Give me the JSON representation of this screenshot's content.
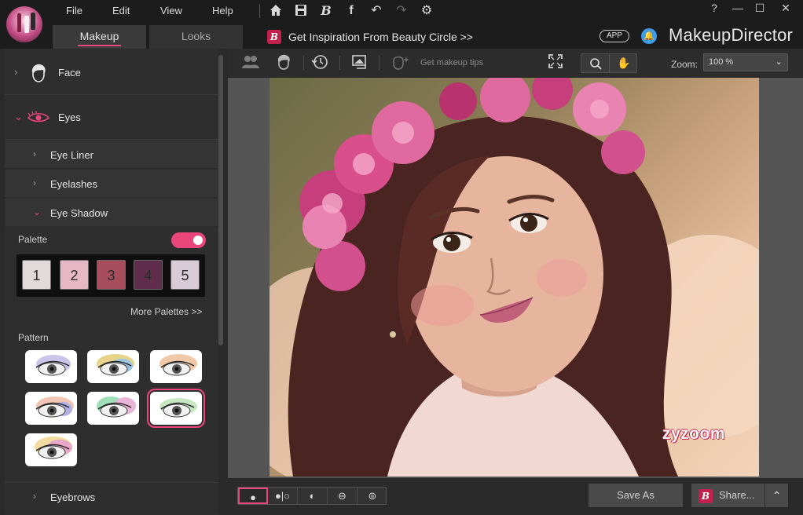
{
  "app": {
    "menu": [
      "File",
      "Edit",
      "View",
      "Help"
    ],
    "window_controls": [
      "?",
      "—",
      "☐",
      "✕"
    ],
    "tabs": [
      {
        "label": "Makeup",
        "active": true
      },
      {
        "label": "Looks",
        "active": false
      }
    ],
    "inspiration": "Get Inspiration From Beauty Circle >>",
    "badge_letter": "B",
    "app_button": "APP",
    "brand": "MakeupDirector",
    "toolbar_icons": [
      "home-icon",
      "save-icon",
      "beauty-circle-icon",
      "facebook-icon",
      "undo-icon",
      "redo-icon",
      "settings-icon"
    ],
    "accent_color": "#e8457a"
  },
  "left": {
    "categories": [
      {
        "label": "Face",
        "expanded": false
      },
      {
        "label": "Eyes",
        "expanded": true
      }
    ],
    "sub": [
      {
        "label": "Eye Liner",
        "expanded": false
      },
      {
        "label": "Eyelashes",
        "expanded": false
      },
      {
        "label": "Eye Shadow",
        "expanded": true
      }
    ],
    "palette_label": "Palette",
    "palette_toggle": true,
    "swatches": [
      {
        "n": "1",
        "color": "#e2d9d9"
      },
      {
        "n": "2",
        "color": "#e6b8c6"
      },
      {
        "n": "3",
        "color": "#a84d5b"
      },
      {
        "n": "4",
        "color": "#5f2d4b"
      },
      {
        "n": "5",
        "color": "#d9cbd6"
      }
    ],
    "more_palettes": "More Palettes >>",
    "pattern_label": "Pattern",
    "patterns_count_selected": 6,
    "eyebrows": "Eyebrows"
  },
  "toolbar": {
    "icons": [
      "face-compare-icon",
      "face-detect-icon",
      "history-icon",
      "crop-icon",
      "makeup-tips-icon",
      "fullscreen-icon",
      "search-icon",
      "hand-icon"
    ],
    "tips": "Get makeup tips",
    "zoom_label": "Zoom:",
    "zoom_value": "100 %"
  },
  "canvas": {
    "watermark": "zyzoom"
  },
  "bottom": {
    "compare_modes": [
      "single-view-icon",
      "side-by-side-icon",
      "split-vertical-icon",
      "split-horizontal-icon",
      "split-diagonal-icon"
    ],
    "save_as": "Save As",
    "share": "Share..."
  }
}
